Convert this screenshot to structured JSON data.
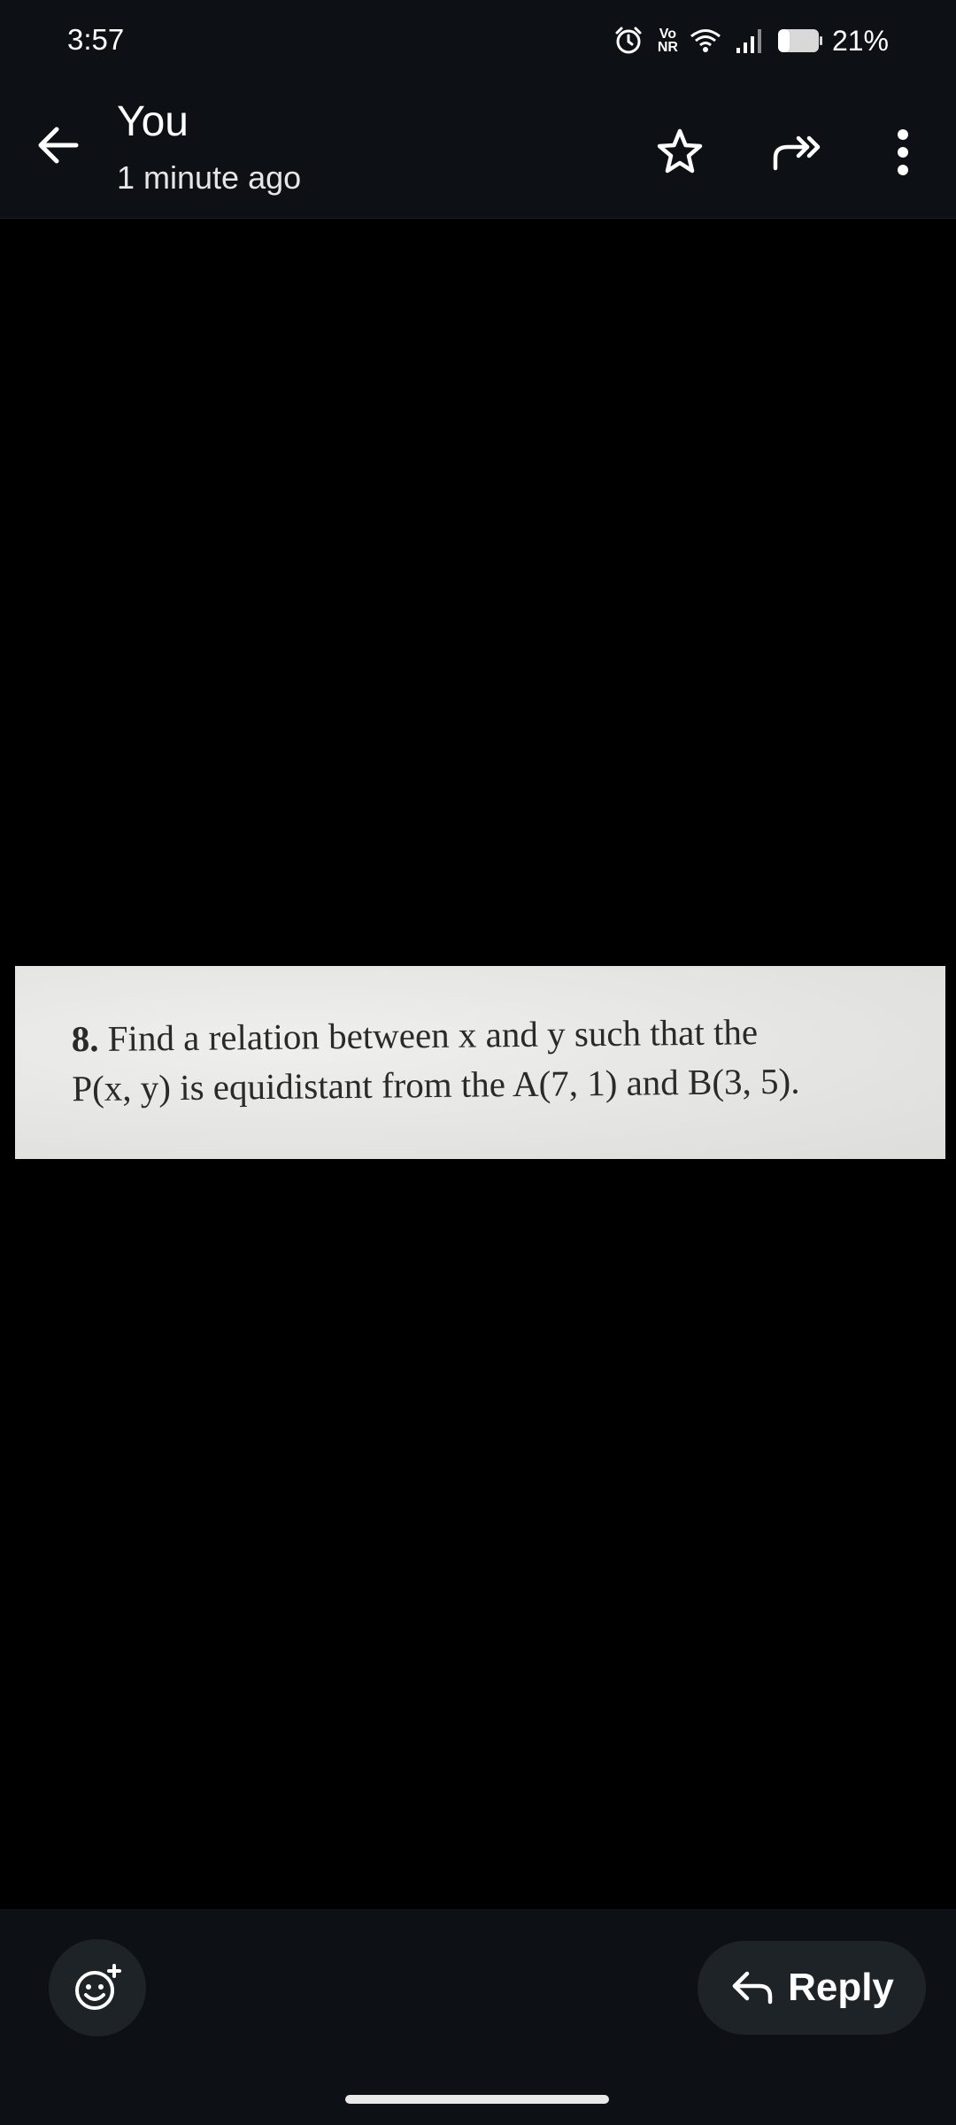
{
  "status": {
    "time": "3:57",
    "battery_percent": "21%",
    "vo_label": "Vo",
    "nr_label": "NR"
  },
  "header": {
    "sender": "You",
    "timestamp": "1 minute ago",
    "icons": [
      "back-arrow-icon",
      "star-icon",
      "forward-icon",
      "more-vert-icon"
    ]
  },
  "photo": {
    "number": "8.",
    "line1": " Find a relation between x and y such that the",
    "line2": "P(x, y) is equidistant from the A(7, 1) and B(3, 5)."
  },
  "footer": {
    "reply_label": "Reply",
    "icons": [
      "add-reaction-icon",
      "reply-icon"
    ]
  },
  "colors": {
    "bar_background": "#0d1014",
    "button_background": "#1e2328",
    "photo_paper": "#e8e8e6"
  }
}
